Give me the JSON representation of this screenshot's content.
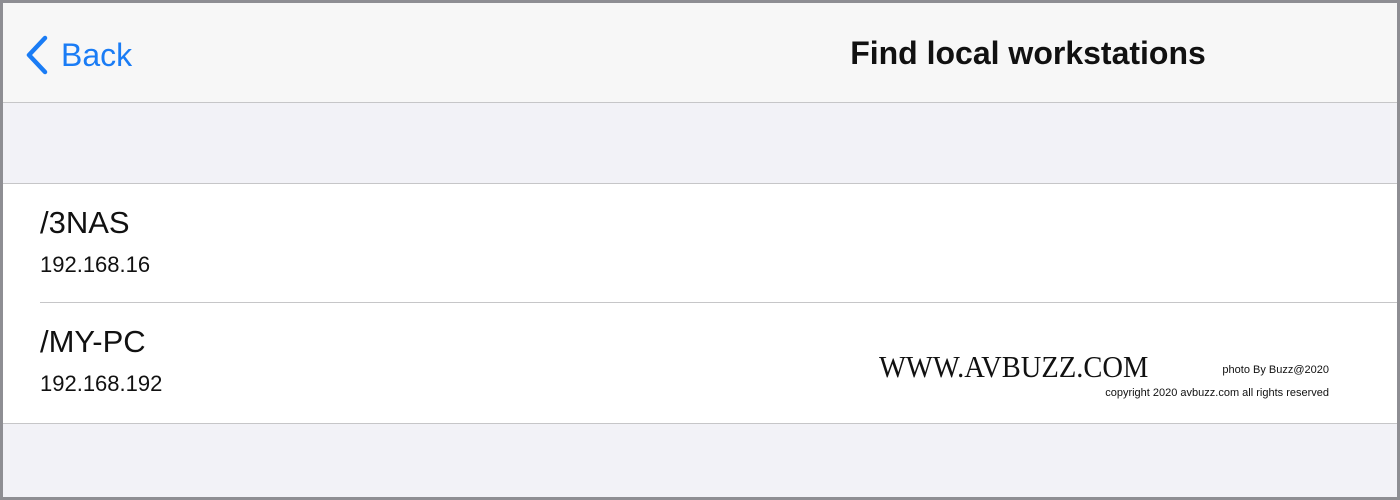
{
  "navbar": {
    "back_label": "Back",
    "title": "Find local workstations"
  },
  "workstations": [
    {
      "name": "/3NAS",
      "ip": "192.168.16"
    },
    {
      "name": "/MY-PC",
      "ip": "192.168.192"
    }
  ],
  "watermark": {
    "site": "WWW.AVBUZZ.COM",
    "photo_credit": "photo By Buzz@2020",
    "copyright": "copyright 2020 avbuzz.com all rights reserved"
  },
  "colors": {
    "accent": "#1a7cf5",
    "grouped_background": "#f2f2f7",
    "separator": "#c6c6c8"
  },
  "icons": {
    "back": "chevron-left-icon"
  }
}
